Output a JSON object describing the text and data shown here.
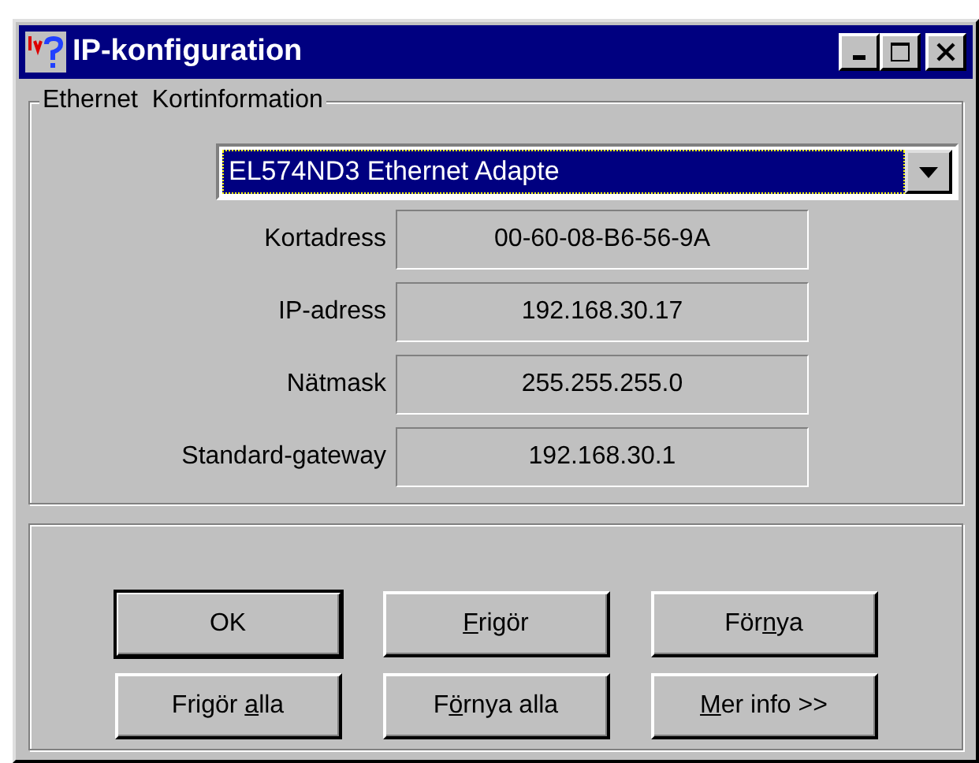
{
  "window": {
    "title": "IP-konfiguration"
  },
  "adapter_group": {
    "label": "Ethernet  Kortinformation",
    "adapter_dropdown": {
      "value": "EL574ND3 Ethernet Adapte",
      "focused": true
    },
    "fields": [
      {
        "label": "Kortadress",
        "value": "00-60-08-B6-56-9A"
      },
      {
        "label": "IP-adress",
        "value": "192.168.30.17"
      },
      {
        "label": "Nätmask",
        "value": "255.255.255.0"
      },
      {
        "label": "Standard-gateway",
        "value": "192.168.30.1"
      }
    ]
  },
  "buttons": [
    {
      "label": "OK",
      "default": true
    },
    {
      "access_key": "F",
      "after": "rigör",
      "default": false
    },
    {
      "before": "För",
      "access_key": "n",
      "after": "ya",
      "default": false
    },
    {
      "before": "Frigör ",
      "access_key": "a",
      "after": "lla",
      "default": false
    },
    {
      "before": "F",
      "access_key": "ö",
      "after": "rnya alla",
      "default": false
    },
    {
      "access_key": "M",
      "after": "er info >>",
      "default": false
    }
  ]
}
